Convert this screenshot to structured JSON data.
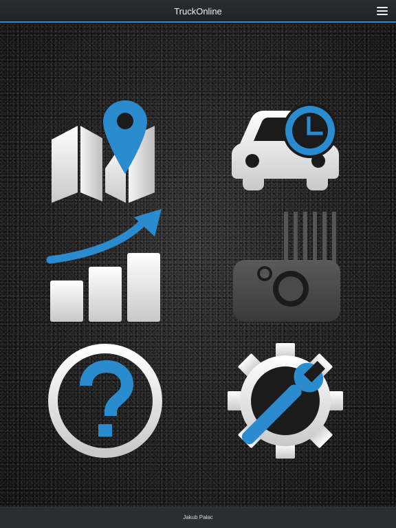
{
  "app": {
    "title": "TruckOnline"
  },
  "header": {
    "menu_icon": "hamburger-menu-icon"
  },
  "tiles": [
    {
      "id": "map",
      "icon": "map-location-icon"
    },
    {
      "id": "vehicle-history",
      "icon": "car-clock-icon"
    },
    {
      "id": "statistics",
      "icon": "bar-chart-growth-icon"
    },
    {
      "id": "fuel-tank",
      "icon": "fuel-tank-gauge-icon"
    },
    {
      "id": "help",
      "icon": "question-mark-icon"
    },
    {
      "id": "settings",
      "icon": "gear-wrench-icon"
    }
  ],
  "footer": {
    "author": "Jakub Pałac"
  },
  "colors": {
    "accent_blue": "#2a8ccf",
    "icon_silver": "#e6e6e6",
    "header_bg": "#2a2d31"
  }
}
